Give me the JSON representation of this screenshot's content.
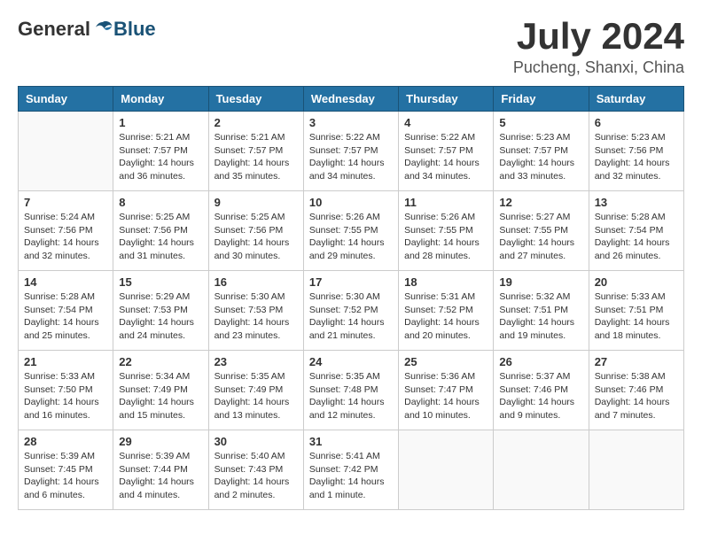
{
  "header": {
    "logo": {
      "general": "General",
      "blue": "Blue"
    },
    "title": "July 2024",
    "location": "Pucheng, Shanxi, China"
  },
  "calendar": {
    "weekdays": [
      "Sunday",
      "Monday",
      "Tuesday",
      "Wednesday",
      "Thursday",
      "Friday",
      "Saturday"
    ],
    "weeks": [
      [
        {
          "day": "",
          "info": ""
        },
        {
          "day": "1",
          "info": "Sunrise: 5:21 AM\nSunset: 7:57 PM\nDaylight: 14 hours\nand 36 minutes."
        },
        {
          "day": "2",
          "info": "Sunrise: 5:21 AM\nSunset: 7:57 PM\nDaylight: 14 hours\nand 35 minutes."
        },
        {
          "day": "3",
          "info": "Sunrise: 5:22 AM\nSunset: 7:57 PM\nDaylight: 14 hours\nand 34 minutes."
        },
        {
          "day": "4",
          "info": "Sunrise: 5:22 AM\nSunset: 7:57 PM\nDaylight: 14 hours\nand 34 minutes."
        },
        {
          "day": "5",
          "info": "Sunrise: 5:23 AM\nSunset: 7:57 PM\nDaylight: 14 hours\nand 33 minutes."
        },
        {
          "day": "6",
          "info": "Sunrise: 5:23 AM\nSunset: 7:56 PM\nDaylight: 14 hours\nand 32 minutes."
        }
      ],
      [
        {
          "day": "7",
          "info": "Sunrise: 5:24 AM\nSunset: 7:56 PM\nDaylight: 14 hours\nand 32 minutes."
        },
        {
          "day": "8",
          "info": "Sunrise: 5:25 AM\nSunset: 7:56 PM\nDaylight: 14 hours\nand 31 minutes."
        },
        {
          "day": "9",
          "info": "Sunrise: 5:25 AM\nSunset: 7:56 PM\nDaylight: 14 hours\nand 30 minutes."
        },
        {
          "day": "10",
          "info": "Sunrise: 5:26 AM\nSunset: 7:55 PM\nDaylight: 14 hours\nand 29 minutes."
        },
        {
          "day": "11",
          "info": "Sunrise: 5:26 AM\nSunset: 7:55 PM\nDaylight: 14 hours\nand 28 minutes."
        },
        {
          "day": "12",
          "info": "Sunrise: 5:27 AM\nSunset: 7:55 PM\nDaylight: 14 hours\nand 27 minutes."
        },
        {
          "day": "13",
          "info": "Sunrise: 5:28 AM\nSunset: 7:54 PM\nDaylight: 14 hours\nand 26 minutes."
        }
      ],
      [
        {
          "day": "14",
          "info": "Sunrise: 5:28 AM\nSunset: 7:54 PM\nDaylight: 14 hours\nand 25 minutes."
        },
        {
          "day": "15",
          "info": "Sunrise: 5:29 AM\nSunset: 7:53 PM\nDaylight: 14 hours\nand 24 minutes."
        },
        {
          "day": "16",
          "info": "Sunrise: 5:30 AM\nSunset: 7:53 PM\nDaylight: 14 hours\nand 23 minutes."
        },
        {
          "day": "17",
          "info": "Sunrise: 5:30 AM\nSunset: 7:52 PM\nDaylight: 14 hours\nand 21 minutes."
        },
        {
          "day": "18",
          "info": "Sunrise: 5:31 AM\nSunset: 7:52 PM\nDaylight: 14 hours\nand 20 minutes."
        },
        {
          "day": "19",
          "info": "Sunrise: 5:32 AM\nSunset: 7:51 PM\nDaylight: 14 hours\nand 19 minutes."
        },
        {
          "day": "20",
          "info": "Sunrise: 5:33 AM\nSunset: 7:51 PM\nDaylight: 14 hours\nand 18 minutes."
        }
      ],
      [
        {
          "day": "21",
          "info": "Sunrise: 5:33 AM\nSunset: 7:50 PM\nDaylight: 14 hours\nand 16 minutes."
        },
        {
          "day": "22",
          "info": "Sunrise: 5:34 AM\nSunset: 7:49 PM\nDaylight: 14 hours\nand 15 minutes."
        },
        {
          "day": "23",
          "info": "Sunrise: 5:35 AM\nSunset: 7:49 PM\nDaylight: 14 hours\nand 13 minutes."
        },
        {
          "day": "24",
          "info": "Sunrise: 5:35 AM\nSunset: 7:48 PM\nDaylight: 14 hours\nand 12 minutes."
        },
        {
          "day": "25",
          "info": "Sunrise: 5:36 AM\nSunset: 7:47 PM\nDaylight: 14 hours\nand 10 minutes."
        },
        {
          "day": "26",
          "info": "Sunrise: 5:37 AM\nSunset: 7:46 PM\nDaylight: 14 hours\nand 9 minutes."
        },
        {
          "day": "27",
          "info": "Sunrise: 5:38 AM\nSunset: 7:46 PM\nDaylight: 14 hours\nand 7 minutes."
        }
      ],
      [
        {
          "day": "28",
          "info": "Sunrise: 5:39 AM\nSunset: 7:45 PM\nDaylight: 14 hours\nand 6 minutes."
        },
        {
          "day": "29",
          "info": "Sunrise: 5:39 AM\nSunset: 7:44 PM\nDaylight: 14 hours\nand 4 minutes."
        },
        {
          "day": "30",
          "info": "Sunrise: 5:40 AM\nSunset: 7:43 PM\nDaylight: 14 hours\nand 2 minutes."
        },
        {
          "day": "31",
          "info": "Sunrise: 5:41 AM\nSunset: 7:42 PM\nDaylight: 14 hours\nand 1 minute."
        },
        {
          "day": "",
          "info": ""
        },
        {
          "day": "",
          "info": ""
        },
        {
          "day": "",
          "info": ""
        }
      ]
    ]
  }
}
